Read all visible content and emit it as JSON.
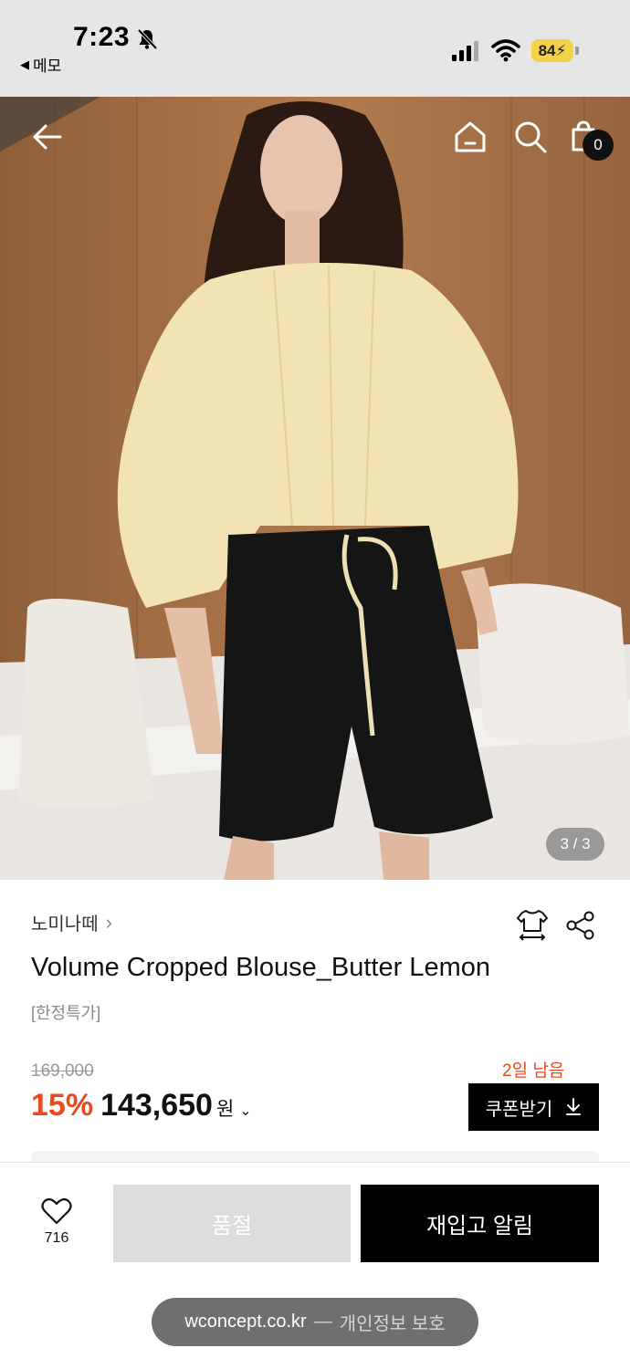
{
  "status_bar": {
    "time": "7:23",
    "back_app": "메모",
    "battery": "84",
    "icons": [
      "bell-slash-icon",
      "signal-icon",
      "wifi-icon",
      "battery-icon"
    ]
  },
  "header_nav": {
    "icons": [
      "back-arrow-icon",
      "home-icon",
      "search-icon",
      "cart-icon"
    ],
    "cart_count": "0"
  },
  "gallery": {
    "page_indicator": "3 / 3"
  },
  "product": {
    "brand": "노미나떼",
    "name": "Volume Cropped Blouse_Butter Lemon",
    "tag": "[한정특가]",
    "original_price": "169,000",
    "discount": "15%",
    "sale_price": "143,650",
    "currency": "원",
    "coupon_days_left": "2일 남음",
    "coupon_label": "쿠폰받기"
  },
  "actions": {
    "wish_count": "716",
    "soldout_label": "품절",
    "restock_label": "재입고 알림"
  },
  "browser": {
    "domain": "wconcept.co.kr",
    "separator": "—",
    "privacy": "개인정보 보호"
  },
  "colors": {
    "accent": "#ea4a1c",
    "battery": "#f4d245",
    "soldout_bg": "#dcdcdc"
  }
}
